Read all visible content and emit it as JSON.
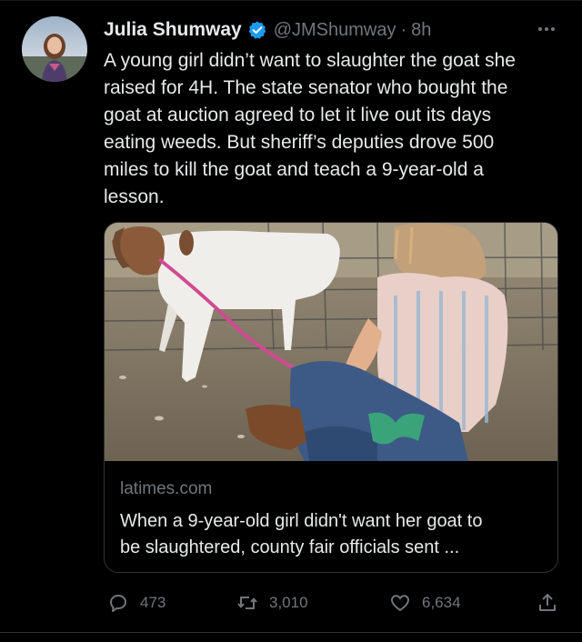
{
  "tweet": {
    "author_name": "Julia Shumway",
    "handle": "@JMShumway",
    "separator": "·",
    "time_ago": "8h",
    "verified_icon": "verified-badge-icon",
    "more_icon": "more-dots-icon",
    "text_lines": [
      "A young girl didn’t want to slaughter the goat she",
      "raised for 4H. The state senator who bought the",
      "goat at auction agreed to let it live out its days",
      "eating weeds. But sheriff’s deputies drove 500",
      "miles to kill the goat and teach a 9-year-old a",
      "lesson."
    ]
  },
  "link_card": {
    "domain": "latimes.com",
    "title_lines": [
      "When a 9-year-old girl didn't want her goat to",
      "be slaughtered, county fair officials sent ..."
    ]
  },
  "actions": {
    "replies": "473",
    "retweets": "3,010",
    "likes": "6,634"
  },
  "colors": {
    "background": "#000000",
    "text_primary": "#e7e9ea",
    "text_secondary": "#71767b",
    "verified": "#1d9bf0",
    "border": "#2f3336"
  }
}
